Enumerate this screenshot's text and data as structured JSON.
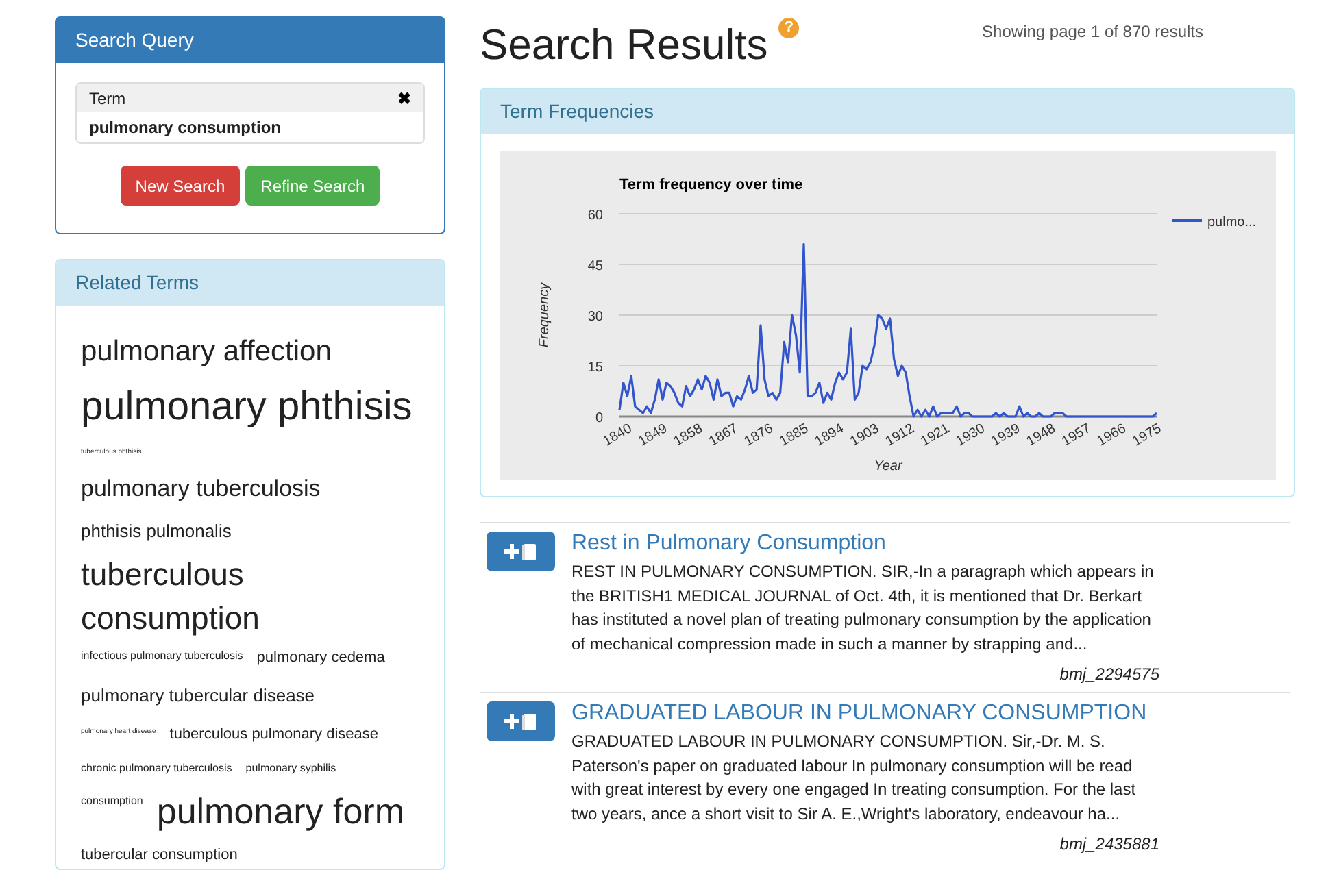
{
  "search_query": {
    "title": "Search Query",
    "term_label": "Term",
    "remove": "✖",
    "term": "pulmonary consumption",
    "buttons": [
      {
        "label": "New Search",
        "kind": "danger"
      },
      {
        "label": "Refine Search",
        "kind": "success"
      }
    ]
  },
  "related_terms": {
    "title": "Related Terms",
    "rows": [
      [
        {
          "label": "pulmonary affection",
          "kind": "xl"
        }
      ],
      [
        {
          "label": "pulmonary phthisis",
          "kind": "max"
        }
      ],
      [
        {
          "label": "tuberculous phthisis",
          "kind": "xs"
        }
      ],
      [
        {
          "label": "pulmonary tuberculosis",
          "kind": "lg"
        }
      ],
      [
        {
          "label": "phthisis pulmonalis",
          "kind": "md"
        }
      ],
      [
        {
          "label": "tuberculous consumption",
          "kind": "xxl"
        }
      ],
      [
        {
          "label": "infectious pulmonary tuberculosis",
          "kind": "sm"
        },
        {
          "label": "pulmonary cedema",
          "kind": "ms"
        }
      ],
      [
        {
          "label": "pulmonary tubercular disease",
          "kind": "md"
        }
      ],
      [
        {
          "label": "pulmonary heart disease",
          "kind": "xs"
        },
        {
          "label": "tuberculous pulmonary disease",
          "kind": "ms"
        }
      ],
      [
        {
          "label": "chronic pulmonary tuberculosis",
          "kind": "sm"
        },
        {
          "label": "pulmonary syphilis",
          "kind": "sm"
        }
      ],
      [
        {
          "label": "consumption",
          "kind": "sm"
        },
        {
          "label": "pulmonary form",
          "kind": "huge"
        }
      ],
      [
        {
          "label": "tubercular consumption",
          "kind": "ms"
        }
      ]
    ]
  },
  "header": {
    "title": "Search Results",
    "help": "?",
    "paging": "Showing page 1 of 870 results"
  },
  "term_frequencies": {
    "title": "Term Frequencies",
    "chart_data": {
      "type": "line",
      "title": "Term frequency over time",
      "xlabel": "Year",
      "ylabel": "Frequency",
      "x": [
        1840,
        1841,
        1842,
        1843,
        1844,
        1845,
        1846,
        1847,
        1848,
        1849,
        1850,
        1851,
        1852,
        1853,
        1854,
        1855,
        1856,
        1857,
        1858,
        1859,
        1860,
        1861,
        1862,
        1863,
        1864,
        1865,
        1866,
        1867,
        1868,
        1869,
        1870,
        1871,
        1872,
        1873,
        1874,
        1875,
        1876,
        1877,
        1878,
        1879,
        1880,
        1881,
        1882,
        1883,
        1884,
        1885,
        1886,
        1887,
        1888,
        1889,
        1890,
        1891,
        1892,
        1893,
        1894,
        1895,
        1896,
        1897,
        1898,
        1899,
        1900,
        1901,
        1902,
        1903,
        1904,
        1905,
        1906,
        1907,
        1908,
        1909,
        1910,
        1911,
        1912,
        1913,
        1914,
        1915,
        1916,
        1917,
        1918,
        1919,
        1920,
        1921,
        1922,
        1923,
        1924,
        1925,
        1926,
        1927,
        1928,
        1929,
        1930,
        1931,
        1932,
        1933,
        1934,
        1935,
        1936,
        1937,
        1938,
        1939,
        1940,
        1941,
        1942,
        1943,
        1944,
        1945,
        1946,
        1947,
        1948,
        1949,
        1950,
        1951,
        1952,
        1953,
        1954,
        1955,
        1956,
        1957,
        1958,
        1959,
        1960,
        1961,
        1962,
        1963,
        1964,
        1965,
        1966,
        1967,
        1968,
        1969,
        1970,
        1971,
        1972,
        1973,
        1974,
        1975,
        1976,
        1977
      ],
      "series": [
        {
          "name": "pulmo...",
          "color": "#3355cc",
          "values": [
            2,
            10,
            6,
            12,
            3,
            2,
            1,
            3,
            1,
            5,
            11,
            5,
            10,
            9,
            7,
            4,
            3,
            9,
            6,
            8,
            11,
            8,
            12,
            10,
            5,
            11,
            6,
            7,
            7,
            3,
            6,
            5,
            8,
            12,
            7,
            8,
            27,
            11,
            6,
            7,
            5,
            7,
            22,
            16,
            30,
            24,
            13,
            51,
            6,
            6,
            7,
            10,
            4,
            7,
            5,
            10,
            13,
            11,
            13,
            26,
            5,
            7,
            15,
            14,
            16,
            21,
            30,
            29,
            26,
            29,
            17,
            12,
            15,
            13,
            6,
            0,
            2,
            0,
            2,
            0,
            3,
            0,
            1,
            1,
            1,
            1,
            3,
            0,
            1,
            1,
            0,
            0,
            0,
            0,
            0,
            0,
            1,
            0,
            1,
            0,
            0,
            0,
            3,
            0,
            1,
            0,
            0,
            1,
            0,
            0,
            0,
            1,
            1,
            1,
            0,
            0,
            0,
            0,
            0,
            0,
            0,
            0,
            0,
            0,
            0,
            0,
            0,
            0,
            0,
            0,
            0,
            0,
            0,
            0,
            0,
            0,
            0,
            1
          ]
        }
      ],
      "xlim": [
        1840,
        1977
      ],
      "xticks": [
        1840,
        1849,
        1858,
        1867,
        1876,
        1885,
        1894,
        1903,
        1912,
        1921,
        1930,
        1939,
        1948,
        1957,
        1966,
        1975
      ],
      "yticks": [
        0,
        15,
        30,
        45,
        60
      ],
      "ylim": [
        0,
        60
      ],
      "grid": true
    }
  },
  "results": [
    {
      "title": "Rest in Pulmonary Consumption",
      "snippet": "REST IN PULMONARY CONSUMPTION. SIR,-In a paragraph which appears in the BRITISH1 MEDICAL JOURNAL of Oct. 4th, it is mentioned that Dr. Berkart has instituted a novel plan of treating pulmonary consumption by the application of mechanical compression made in such a manner by strapping and...",
      "id": "bmj_2294575"
    },
    {
      "title": "GRADUATED LABOUR IN PULMONARY CONSUMPTION",
      "snippet": "GRADUATED LABOUR IN PULMONARY CONSUMPTION. Sir,-Dr. M. S. Paterson's paper on graduated labour In pulmonary consumption will be read with great interest by every one engaged In treating consumption. For the last two years, ance a short visit to Sir A. E.,Wright's laboratory, endeavour ha...",
      "id": "bmj_2435881"
    }
  ]
}
